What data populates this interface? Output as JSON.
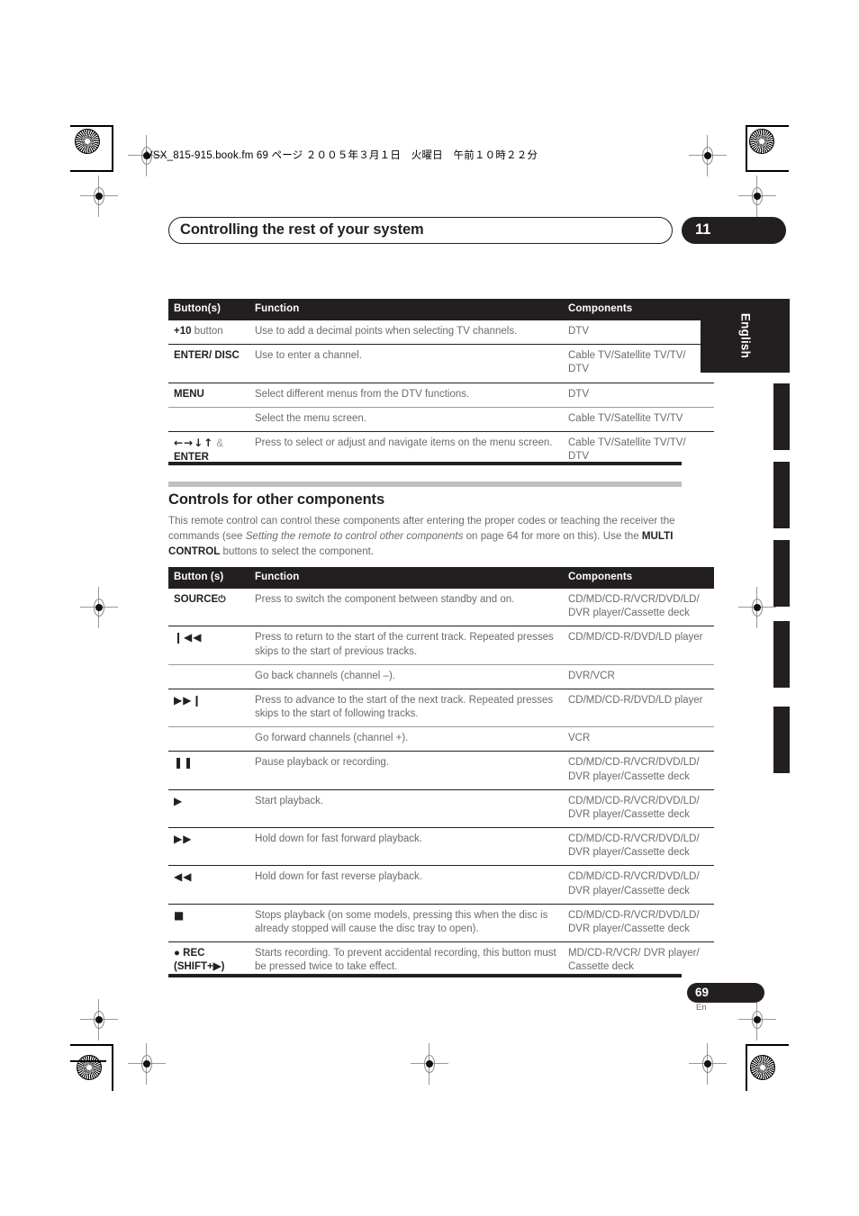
{
  "print_marks": {
    "file_header": "VSX_815-915.book.fm  69 ページ  ２００５年３月１日　火曜日　午前１０時２２分"
  },
  "header": {
    "chapter_title": "Controlling the rest of your system",
    "chapter_number": "11"
  },
  "side_tab": {
    "language": "English"
  },
  "table_top": {
    "columns": [
      "Button(s)",
      "Function",
      "Components"
    ],
    "rows": [
      {
        "button_bold": "+10",
        "button_regular": " button",
        "function": "Use to add a decimal points when selecting TV channels.",
        "components": "DTV",
        "divider": "major"
      },
      {
        "button_bold": "ENTER/ DISC",
        "button_regular": "",
        "function": "Use to enter a channel.",
        "components": "Cable TV/Satellite TV/TV/ DTV",
        "divider": "major"
      },
      {
        "button_bold": "MENU",
        "button_regular": "",
        "function": "Select different menus from the DTV functions.",
        "components": "DTV",
        "divider": "major"
      },
      {
        "button_bold": "",
        "button_regular": "",
        "function": "Select the menu screen.",
        "components": "Cable TV/Satellite TV/TV",
        "divider": "minor"
      },
      {
        "button_bold": "ENTER",
        "button_glyphs": "←→↓↑",
        "button_amp": "&",
        "button_regular": "",
        "function": "Press to select or adjust and navigate items on the menu screen.",
        "components": "Cable TV/Satellite TV/TV/ DTV",
        "divider": "major"
      }
    ]
  },
  "section": {
    "heading": "Controls for other components",
    "body_1": "This remote control can control these components after entering the proper codes or teaching the receiver the commands (see ",
    "body_italic": "Setting the remote to control other components",
    "body_2": " on page 64 for more on this). Use the ",
    "body_bold": "MULTI CONTROL",
    "body_3": " buttons to select the component."
  },
  "table_bottom": {
    "columns": [
      "Button (s)",
      "Function",
      "Components"
    ],
    "rows": [
      {
        "button_label": "SOURCE",
        "button_glyph": "⏻",
        "function": "Press to switch the component between standby and on.",
        "components": "CD/MD/CD-R/VCR/DVD/LD/ DVR player/Cassette deck",
        "divider": "major"
      },
      {
        "button_label": "",
        "button_glyph": "❙◀◀",
        "function": "Press to return to the start of the current track. Repeated presses skips to the start of previous tracks.",
        "components": "CD/MD/CD-R/DVD/LD player",
        "divider": "major"
      },
      {
        "button_label": "",
        "button_glyph": "",
        "function": "Go back channels (channel –).",
        "components": "DVR/VCR",
        "divider": "minor"
      },
      {
        "button_label": "",
        "button_glyph": "▶▶❙",
        "function": "Press to advance to the start of the next track. Repeated presses skips to the start of following tracks.",
        "components": "CD/MD/CD-R/DVD/LD player",
        "divider": "major"
      },
      {
        "button_label": "",
        "button_glyph": "",
        "function": "Go forward channels (channel +).",
        "components": "VCR",
        "divider": "minor"
      },
      {
        "button_label": "",
        "button_glyph": "❚❚",
        "function": "Pause playback or recording.",
        "components": "CD/MD/CD-R/VCR/DVD/LD/ DVR player/Cassette deck",
        "divider": "major"
      },
      {
        "button_label": "",
        "button_glyph": "▶",
        "function": "Start playback.",
        "components": "CD/MD/CD-R/VCR/DVD/LD/ DVR player/Cassette deck",
        "divider": "major"
      },
      {
        "button_label": "",
        "button_glyph": "▶▶",
        "function": "Hold down for fast forward playback.",
        "components": "CD/MD/CD-R/VCR/DVD/LD/ DVR player/Cassette deck",
        "divider": "major"
      },
      {
        "button_label": "",
        "button_glyph": "◀◀",
        "function": "Hold down for fast reverse playback.",
        "components": "CD/MD/CD-R/VCR/DVD/LD/ DVR player/Cassette deck",
        "divider": "major"
      },
      {
        "button_label": "",
        "button_glyph": "■",
        "function": "Stops playback (on some models, pressing this when the disc is already stopped will cause the disc tray to open).",
        "components": "CD/MD/CD-R/VCR/DVD/LD/ DVR player/Cassette deck",
        "divider": "major"
      },
      {
        "button_label": "● REC (SHIFT+▶)",
        "button_glyph": "",
        "function": "Starts recording. To prevent accidental recording, this button must be pressed twice to take effect.",
        "components": "MD/CD-R/VCR/ DVR player/ Cassette deck",
        "divider": "major"
      }
    ]
  },
  "footer": {
    "page_number": "69",
    "page_language": "En"
  },
  "colors": {
    "ink": "#231f20",
    "body_text": "#6b6b6b",
    "rule_gray": "#bfbfbf"
  }
}
